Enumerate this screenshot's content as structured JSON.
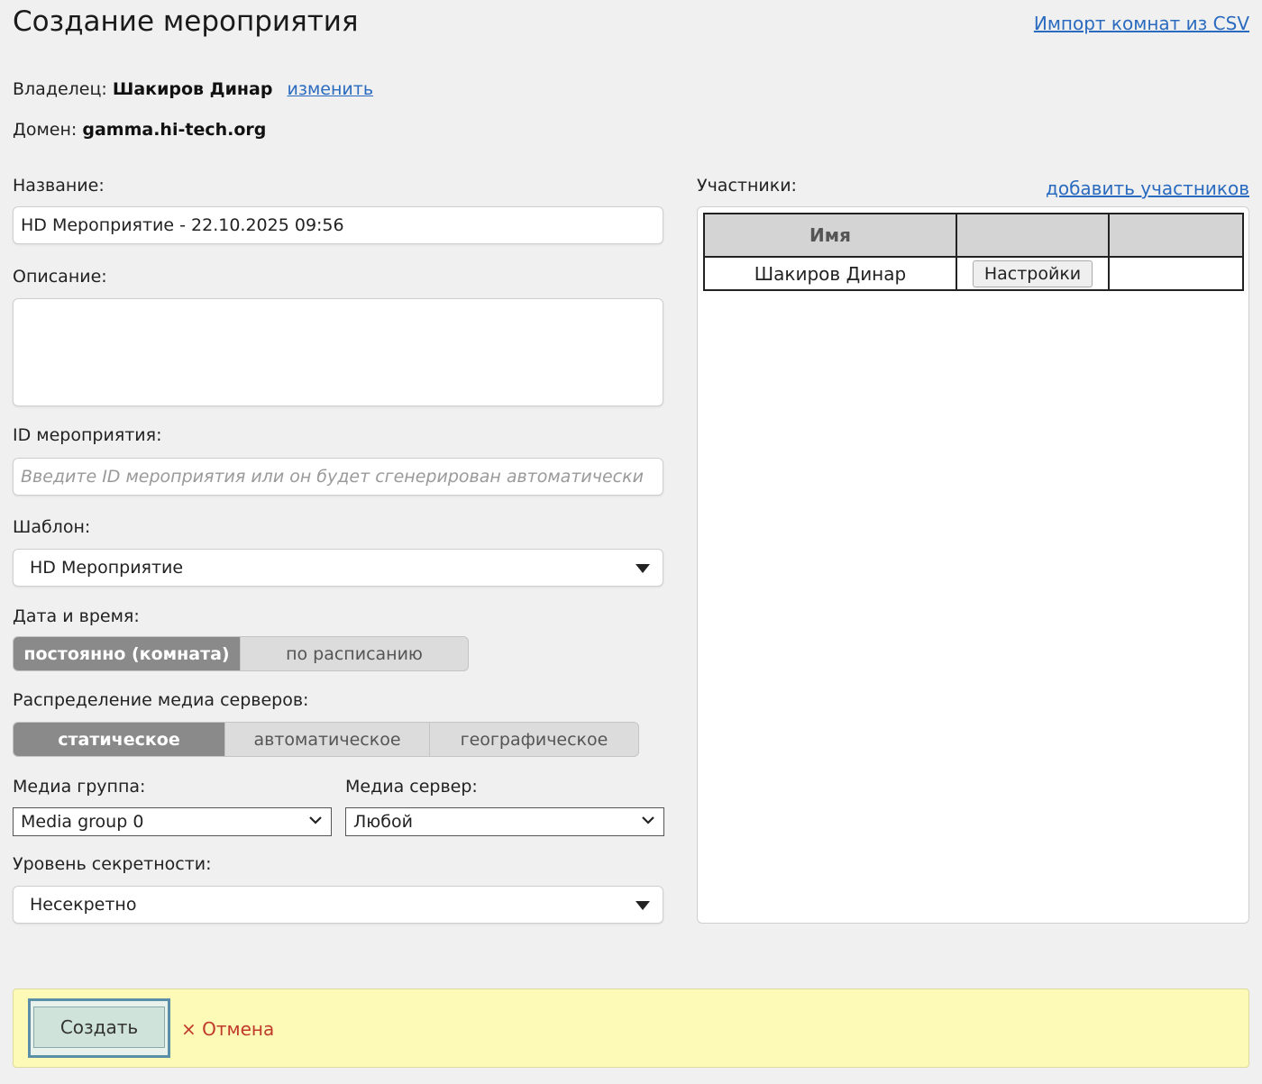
{
  "page": {
    "title": "Создание мероприятия",
    "import_link": "Импорт комнат из CSV"
  },
  "owner": {
    "label": "Владелец:",
    "name": "Шакиров Динар",
    "change_link": "изменить"
  },
  "domain": {
    "label": "Домен:",
    "value": "gamma.hi-tech.org"
  },
  "form": {
    "name_label": "Название:",
    "name_value": "HD Мероприятие - 22.10.2025 09:56",
    "description_label": "Описание:",
    "description_value": "",
    "event_id_label": "ID мероприятия:",
    "event_id_placeholder": "Введите ID мероприятия или он будет сгенерирован автоматически",
    "template_label": "Шаблон:",
    "template_value": "HD Мероприятие",
    "datetime_label": "Дата и время:",
    "datetime_options": [
      "постоянно (комната)",
      "по расписанию"
    ],
    "datetime_selected": 0,
    "distribution_label": "Распределение медиа серверов:",
    "distribution_options": [
      "статическое",
      "автоматическое",
      "географическое"
    ],
    "distribution_selected": 0,
    "media_group_label": "Медиа группа:",
    "media_group_value": "Media group 0",
    "media_server_label": "Медиа сервер:",
    "media_server_value": "Любой",
    "security_label": "Уровень секретности:",
    "security_value": "Несекретно"
  },
  "participants": {
    "label": "Участники:",
    "add_link": "добавить участников",
    "columns": [
      "Имя",
      "",
      ""
    ],
    "rows": [
      {
        "name": "Шакиров Динар",
        "settings_label": "Настройки"
      }
    ]
  },
  "footer": {
    "create_label": "Создать",
    "cancel_icon": "×",
    "cancel_label": "Отмена"
  },
  "colors": {
    "link": "#2a6bbf",
    "footer_bg": "#fdf9b6",
    "cancel": "#c0392b",
    "segment_active": "#8a8a8a"
  }
}
